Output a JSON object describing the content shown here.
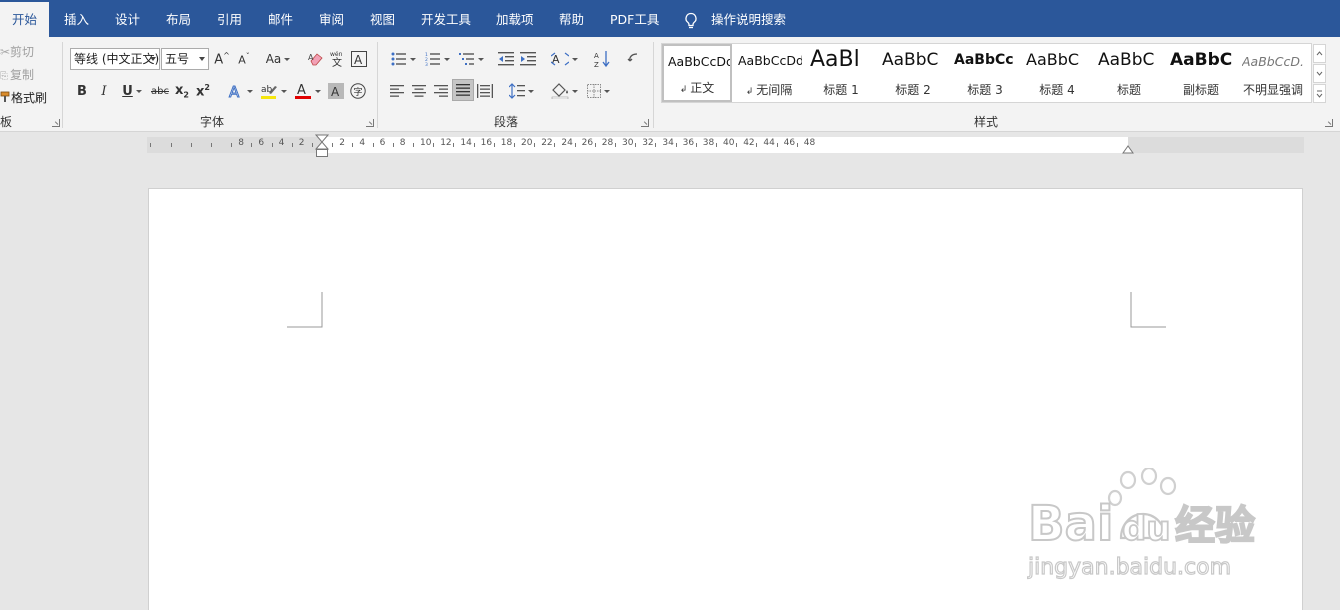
{
  "tabs": [
    {
      "label": "开始",
      "active": true
    },
    {
      "label": "插入"
    },
    {
      "label": "设计"
    },
    {
      "label": "布局"
    },
    {
      "label": "引用"
    },
    {
      "label": "邮件"
    },
    {
      "label": "审阅"
    },
    {
      "label": "视图"
    },
    {
      "label": "开发工具"
    },
    {
      "label": "加载项"
    },
    {
      "label": "帮助"
    },
    {
      "label": "PDF工具"
    }
  ],
  "tell_me": {
    "label": "操作说明搜索",
    "icon": "lightbulb-icon"
  },
  "clipboard": {
    "cut": "剪切",
    "copy": "复制",
    "format_painter": "格式刷",
    "group_label": "板"
  },
  "font": {
    "family": "等线 (中文正文)",
    "size": "五号",
    "change_case": "Aa",
    "group_label": "字体",
    "colors": {
      "highlight": "#f5e60f",
      "font_color": "#e00000"
    }
  },
  "paragraph": {
    "group_label": "段落"
  },
  "styles": {
    "group_label": "样式",
    "items": [
      {
        "preview": "AaBbCcDd",
        "name": "正文",
        "selected": true
      },
      {
        "preview": "AaBbCcDd",
        "name": "无间隔"
      },
      {
        "preview": "AaBl",
        "name": "标题 1"
      },
      {
        "preview": "AaBbC",
        "name": "标题 2"
      },
      {
        "preview": "AaBbCc",
        "name": "标题 3"
      },
      {
        "preview": "AaBbC",
        "name": "标题 4"
      },
      {
        "preview": "AaBbC",
        "name": "标题"
      },
      {
        "preview": "AaBbC",
        "name": "副标题"
      },
      {
        "preview": "AaBbCcD.",
        "name": "不明显强调"
      }
    ]
  },
  "ruler": {
    "left_numbers": [
      "8",
      "6",
      "4",
      "2"
    ],
    "right_numbers": [
      "2",
      "4",
      "6",
      "8",
      "10",
      "12",
      "14",
      "16",
      "18",
      "20",
      "22",
      "24",
      "26",
      "28",
      "30",
      "32",
      "34",
      "36",
      "38",
      "40",
      "42",
      "44",
      "46",
      "48"
    ]
  },
  "watermark": {
    "brand": "Bai",
    "brand2": "du",
    "cn": "经验",
    "url": "jingyan.baidu.com"
  },
  "colors": {
    "accent": "#2b579a",
    "ribbon_bg": "#f3f3f3",
    "canvas_bg": "#e6e6e6"
  }
}
